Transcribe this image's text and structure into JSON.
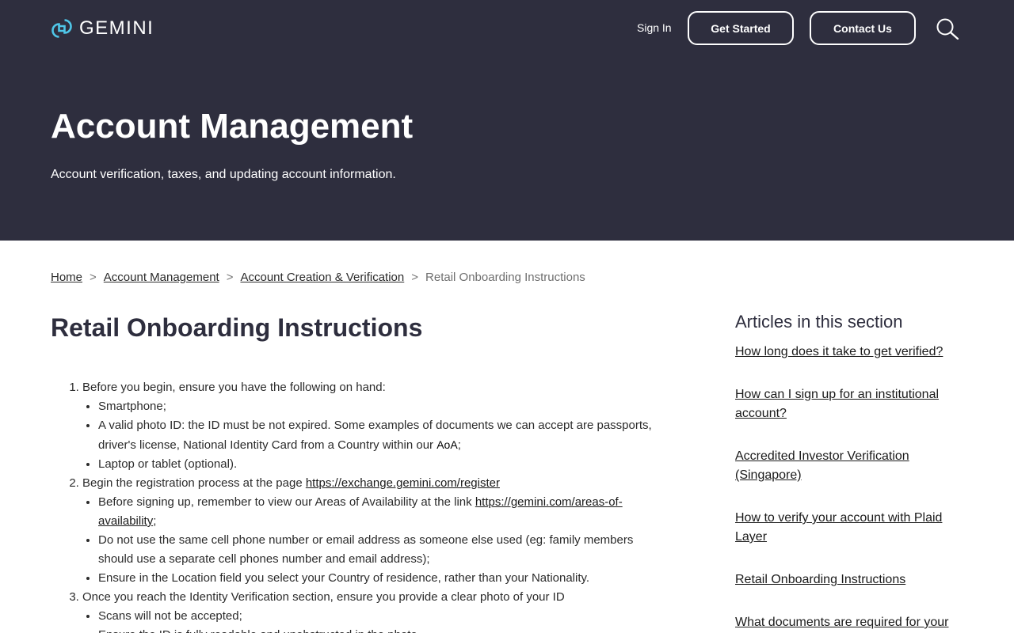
{
  "header": {
    "logo_text": "GEMINI",
    "sign_in": "Sign In",
    "get_started": "Get Started",
    "contact_us": "Contact Us"
  },
  "hero": {
    "title": "Account Management",
    "subtitle": "Account verification, taxes, and updating account information."
  },
  "breadcrumb": {
    "items": [
      "Home",
      "Account Management",
      "Account Creation & Verification"
    ],
    "current": "Retail Onboarding Instructions",
    "separator": ">"
  },
  "article": {
    "title": "Retail Onboarding Instructions",
    "step1": {
      "text": "Before you begin, ensure you have the following on hand:",
      "bullets": {
        "b1": "Smartphone;",
        "b2_text": "A valid photo ID: the ID must be not expired. Some examples of documents we can accept are passports, driver's license, National Identity Card from a Country within our ",
        "b2_abbr": "AoA",
        "b2_end": ";",
        "b3": "Laptop or tablet (optional)."
      }
    },
    "step2": {
      "text": "Begin the registration process at the page ",
      "link": "https://exchange.gemini.com/register",
      "bullets": {
        "b1_text": "Before signing up, remember to view our Areas of Availability at the link ",
        "b1_link": "https://gemini.com/areas-of-availability",
        "b1_end": ";",
        "b2": "Do not use the same cell phone number or email address as someone else used (eg: family members should use a separate cell phones number and email address);",
        "b3": "Ensure in the Location field you select your Country of residence, rather than your Nationality."
      }
    },
    "step3": {
      "text": "Once you reach the Identity Verification section, ensure you provide a clear photo of your ID",
      "bullets": {
        "b1": "Scans will not be accepted;",
        "b2": "Ensure the ID is fully readable and unobstructed in the photo."
      }
    }
  },
  "sidebar": {
    "title": "Articles in this section",
    "items": [
      "How long does it take to get verified?",
      "How can I sign up for an institutional account?",
      "Accredited Investor Verification (Singapore)",
      "How to verify your account with Plaid Layer",
      "Retail Onboarding Instructions",
      "What documents are required for your"
    ]
  },
  "colors": {
    "hero_bg": "#2e2e3e",
    "logo_accent": "#4fc6e8",
    "text": "#2b2b2b"
  },
  "icons": {
    "logo": "gemini-logo-icon",
    "search": "search-icon"
  }
}
